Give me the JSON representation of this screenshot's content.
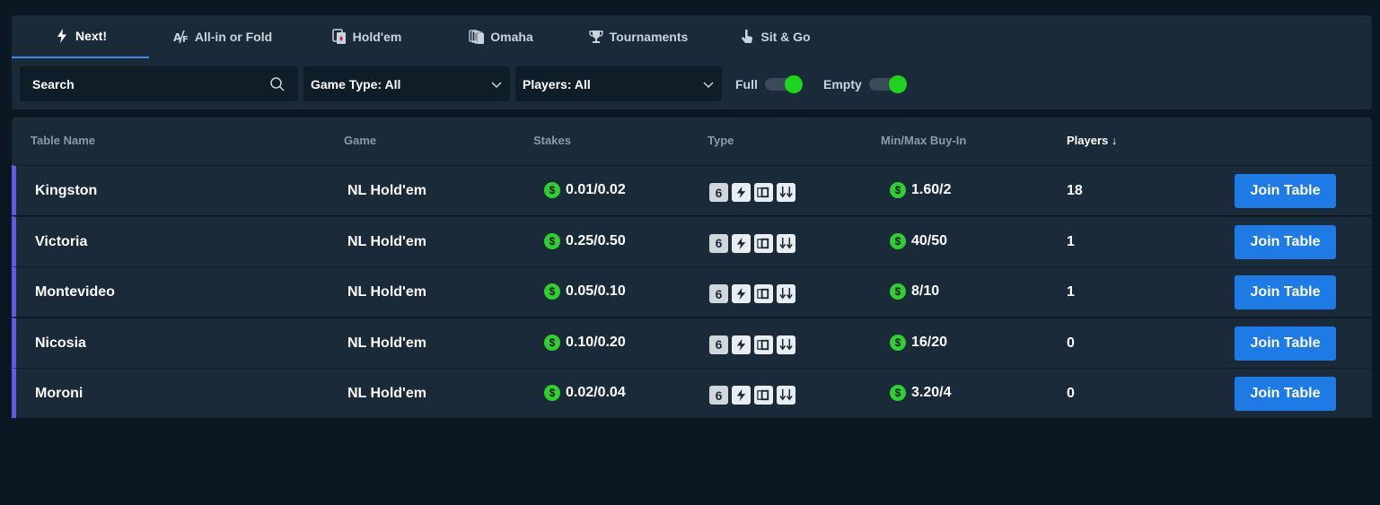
{
  "tabs": [
    {
      "label": "Next!",
      "icon": "lightning-icon",
      "active": true
    },
    {
      "label": "All-in or Fold",
      "icon": "allin-fold-icon",
      "active": false
    },
    {
      "label": "Hold'em",
      "icon": "holdem-cards-icon",
      "active": false
    },
    {
      "label": "Omaha",
      "icon": "omaha-cards-icon",
      "active": false
    },
    {
      "label": "Tournaments",
      "icon": "trophy-icon",
      "active": false
    },
    {
      "label": "Sit & Go",
      "icon": "pointer-hand-icon",
      "active": false
    }
  ],
  "filters": {
    "search_placeholder": "Search",
    "game_type": "Game Type: All",
    "players": "Players: All",
    "full_label": "Full",
    "full_on": true,
    "empty_label": "Empty",
    "empty_on": true
  },
  "table": {
    "headers": {
      "name": "Table Name",
      "game": "Game",
      "stakes": "Stakes",
      "type": "Type",
      "buyin": "Min/Max Buy-In",
      "players": "Players ↓"
    },
    "type_badge": "6",
    "currency_symbol": "$",
    "join_label": "Join Table",
    "rows": [
      {
        "name": "Kingston",
        "game": "NL Hold'em",
        "stakes": "0.01/0.02",
        "buyin": "1.60/2",
        "players": "18"
      },
      {
        "name": "Victoria",
        "game": "NL Hold'em",
        "stakes": "0.25/0.50",
        "buyin": "40/50",
        "players": "1"
      },
      {
        "name": "Montevideo",
        "game": "NL Hold'em",
        "stakes": "0.05/0.10",
        "buyin": "8/10",
        "players": "1"
      },
      {
        "name": "Nicosia",
        "game": "NL Hold'em",
        "stakes": "0.10/0.20",
        "buyin": "16/20",
        "players": "0"
      },
      {
        "name": "Moroni",
        "game": "NL Hold'em",
        "stakes": "0.02/0.04",
        "buyin": "3.20/4",
        "players": "0"
      }
    ]
  },
  "colors": {
    "accent": "#1e7be6",
    "row_marker": "#5d5fe0",
    "toggle_on": "#1fd41f",
    "coin": "#2fcf2f"
  }
}
